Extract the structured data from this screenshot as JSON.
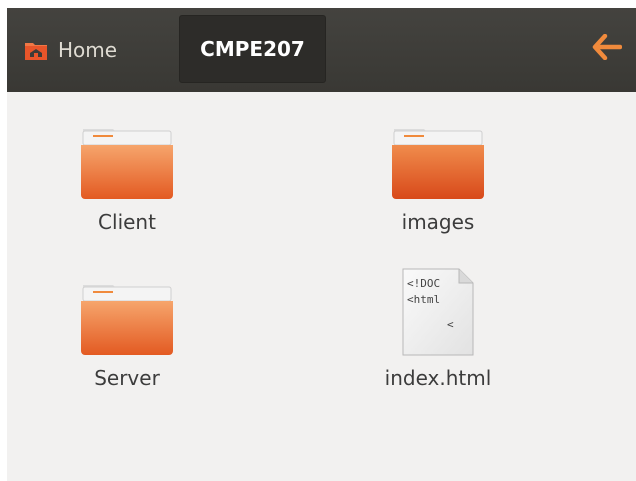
{
  "toolbar": {
    "home_label": "Home",
    "current_folder": "CMPE207",
    "accent_color": "#e95420"
  },
  "files": [
    {
      "name": "Client",
      "type": "folder"
    },
    {
      "name": "images",
      "type": "folder"
    },
    {
      "name": "Server",
      "type": "folder"
    },
    {
      "name": "index.html",
      "type": "html-file",
      "preview_lines": [
        "<!DOC",
        "<html",
        "<"
      ]
    }
  ]
}
